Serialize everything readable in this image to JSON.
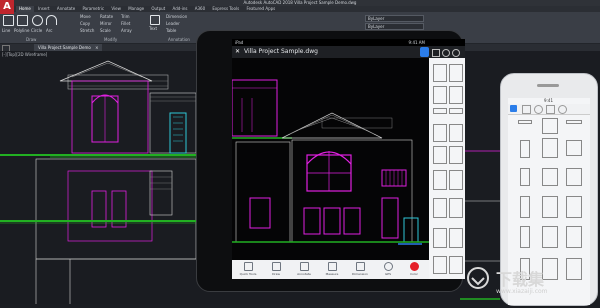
{
  "autocad": {
    "title": "Autodesk AutoCAD 2018  Villa Project Sample Demo.dwg",
    "logo_letter": "A",
    "menu": [
      "Home",
      "Insert",
      "Annotate",
      "Parametric",
      "View",
      "Manage",
      "Output",
      "Add-ins",
      "A360",
      "Express Tools",
      "Featured Apps"
    ],
    "draw_tools": [
      "Line",
      "Polyline",
      "Circle",
      "Arc"
    ],
    "modify_tools": [
      "Move",
      "Copy",
      "Stretch",
      "Rotate",
      "Mirror",
      "Scale",
      "Trim",
      "Fillet",
      "Array"
    ],
    "annotation": [
      "Text",
      "Dimension",
      "Leader",
      "Table"
    ],
    "panels": [
      "Draw",
      "Modify",
      "Annotation"
    ],
    "layer": "ByLayer",
    "doc_tab": "Villa Project Sample Demo",
    "viewport_label": "[-][Top][2D Wireframe]"
  },
  "ipad": {
    "status_left": "iPad",
    "status_right": "9:41 AM",
    "title": "Villa Project Sample.dwg",
    "back": "✕",
    "bottom_tools": [
      "Quick Tools",
      "Draw",
      "Annotate",
      "Measure",
      "Dimension",
      "GPS",
      "Color"
    ]
  },
  "iphone": {
    "status": "9:41"
  },
  "watermark": {
    "text": "下载集",
    "url": "www.xiazaiji.com"
  },
  "colors": {
    "magenta": "#e020e0",
    "green": "#22b022",
    "cyan": "#2fc8d8",
    "accent_blue": "#2b7de9",
    "record_red": "#e5202a"
  }
}
